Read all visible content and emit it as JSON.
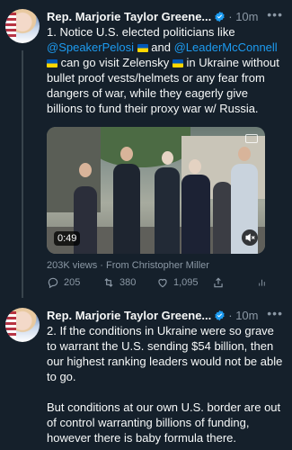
{
  "tweets": [
    {
      "author": "Rep. Marjorie Taylor Greene...",
      "time": "· 10m",
      "text_line1_a": "1. Notice U.S. elected politicians like",
      "mention1": "@SpeakerPelosi",
      "and": " and ",
      "mention2": "@LeaderMcConnell",
      "text_line3": " can go visit Zelensky ",
      "text_line3b": " in Ukraine",
      "text_rest": "without bullet proof vests/helmets or any fear from dangers of war, while they eagerly give billions to fund their proxy war w/ Russia.",
      "video_duration": "0:49",
      "views": "203K views · From Christopher Miller",
      "replies": "205",
      "retweets": "380",
      "likes": "1,095"
    },
    {
      "author": "Rep. Marjorie Taylor Greene...",
      "time": "· 10m",
      "paragraph1": "2. If the conditions in Ukraine were so grave to warrant the U.S. sending $54 billion, then our highest ranking leaders would not be able to go.",
      "paragraph2": "But conditions at our own U.S. border are out of control warranting billions of funding, however there is baby formula there."
    }
  ],
  "colors": {
    "background": "#15202b",
    "accent": "#1d9bf0",
    "muted": "#8b98a5"
  },
  "icons": [
    "verified-badge-icon",
    "more-icon",
    "reply-icon",
    "retweet-icon",
    "like-icon",
    "share-icon",
    "analytics-icon",
    "mute-icon",
    "captions-icon"
  ]
}
